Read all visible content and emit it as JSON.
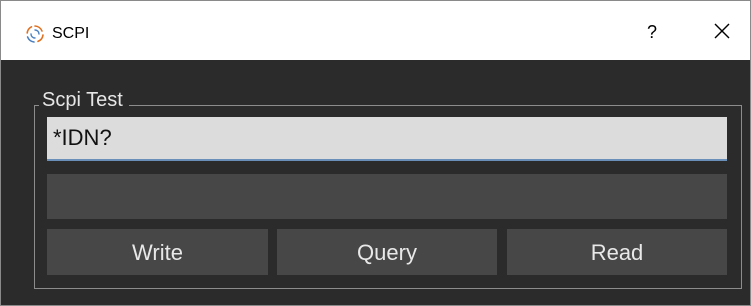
{
  "window": {
    "title": "SCPI",
    "app_icon": "spinner-logo-icon",
    "help_label": "?",
    "close_icon": "close-icon"
  },
  "group": {
    "title": "Scpi Test"
  },
  "command_input": {
    "value": "*IDN?"
  },
  "response_field": {
    "value": ""
  },
  "buttons": {
    "write_label": "Write",
    "query_label": "Query",
    "read_label": "Read"
  },
  "colors": {
    "background": "#2b2b2b",
    "titlebar": "#ffffff",
    "input_background": "#dcdcdc",
    "input_focus_underline": "#6a8fb8",
    "button_background": "#474747",
    "text_light": "#e8e8e8",
    "app_icon_accent": "#e07020",
    "app_icon_blue": "#4a7fc0"
  }
}
